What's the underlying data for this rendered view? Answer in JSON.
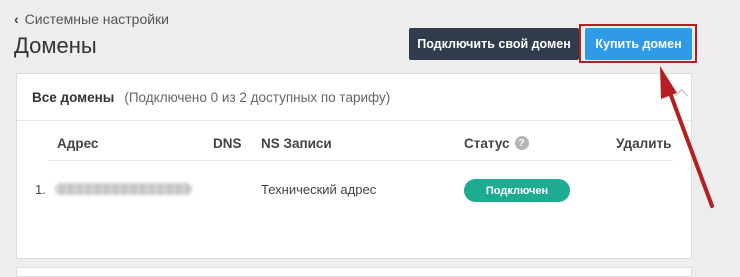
{
  "header": {
    "breadcrumb": "Системные настройки",
    "title": "Домены",
    "connect_button": "Подключить свой домен",
    "buy_button": "Купить домен"
  },
  "panel": {
    "title": "Все домены",
    "subtitle": "(Подключено 0 из 2 доступных по тарифу)",
    "columns": {
      "address": "Адрес",
      "dns": "DNS",
      "ns": "NS Записи",
      "status": "Статус",
      "delete": "Удалить"
    },
    "help_glyph": "?",
    "rows": [
      {
        "number": "1.",
        "ns": "Технический адрес",
        "status": "Подключен"
      }
    ]
  },
  "icons": {
    "back": "chevron-left-icon",
    "help": "question-circle-icon",
    "collapse": "chevron-up-icon",
    "annotation": "red-arrow"
  },
  "colors": {
    "connect_button_bg": "#303c4a",
    "buy_button_bg": "#2f9ae6",
    "status_badge_bg": "#1dab91",
    "annotation_red": "#b51f24"
  }
}
